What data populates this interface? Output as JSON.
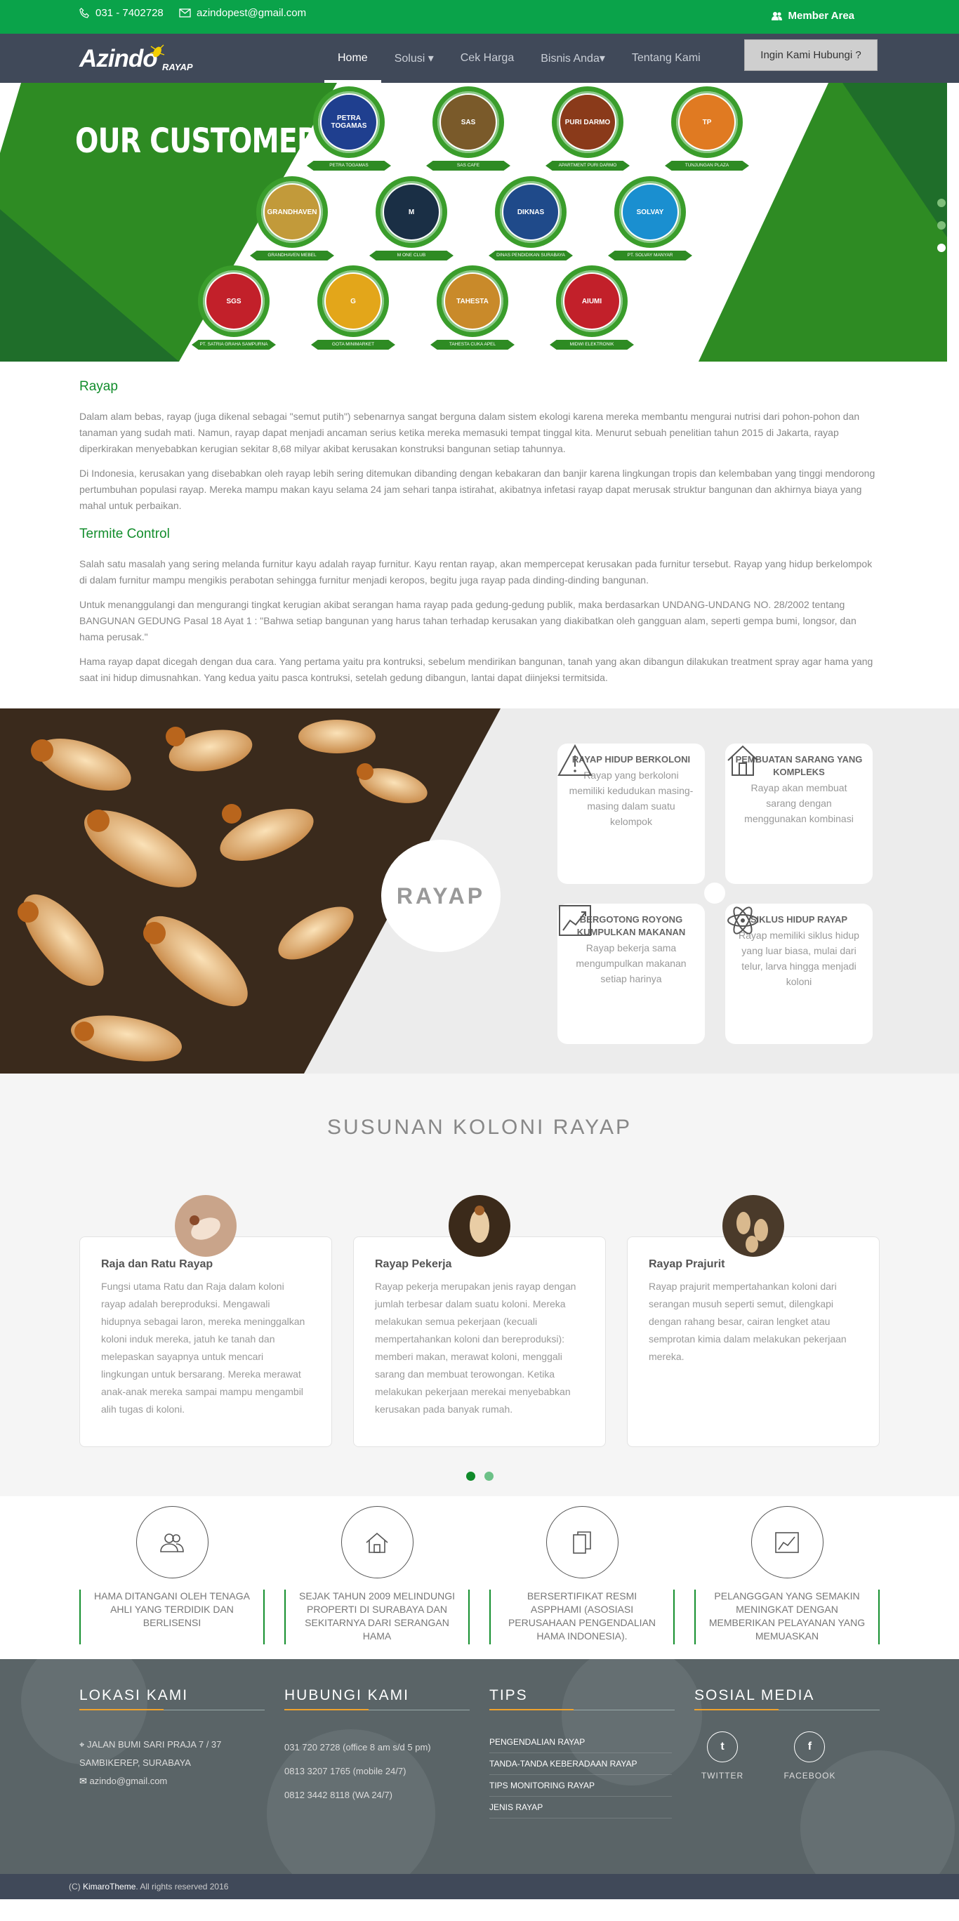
{
  "topbar": {
    "phone": "031 - 7402728",
    "email": "azindopest@gmail.com",
    "member": "Member Area"
  },
  "nav": {
    "logo_main": "Azindo",
    "logo_sub": "RAYAP",
    "items": [
      "Home",
      "Solusi ▾",
      "Cek Harga",
      "Bisnis Anda▾",
      "Tentang Kami"
    ],
    "cta": "Ingin Kami Hubungi ?"
  },
  "hero": {
    "title": "OUR CUSTOMER",
    "customers": [
      {
        "name": "PETRA TOGAMAS",
        "logo": "PETRA TOGAMAS",
        "color": "#1f3f8f"
      },
      {
        "name": "SAS CAFE",
        "logo": "SAS",
        "color": "#7a5a2a"
      },
      {
        "name": "APARTMENT PURI DARMO",
        "logo": "PURI DARMO",
        "color": "#8a3a1a"
      },
      {
        "name": "TUNJUNGAN PLAZA",
        "logo": "TP",
        "color": "#e07a22"
      },
      {
        "name": "GRANDHAVEN MEBEL",
        "logo": "GRANDHAVEN",
        "color": "#c29a3a"
      },
      {
        "name": "M ONE CLUB",
        "logo": "M",
        "color": "#1a2f45"
      },
      {
        "name": "DINAS PENDIDIKAN SURABAYA",
        "logo": "DIKNAS",
        "color": "#1f4a8a"
      },
      {
        "name": "PT. SOLVAY MANYAR",
        "logo": "SOLVAY",
        "color": "#1a8fd0"
      },
      {
        "name": "PT. SATRIA GRAHA SAMPURNA",
        "logo": "SGS",
        "color": "#c2202a"
      },
      {
        "name": "GOTA MINIMARKET",
        "logo": "G",
        "color": "#e3a61a"
      },
      {
        "name": "TAHESTA CUKA APEL",
        "logo": "TAHESTA",
        "color": "#c98a2a"
      },
      {
        "name": "MIDWI ELEKTRONIK",
        "logo": "AIUMI",
        "color": "#c2202a"
      }
    ]
  },
  "content": {
    "h1": "Rayap",
    "p1": "Dalam alam bebas, rayap (juga dikenal sebagai \"semut putih\") sebenarnya sangat berguna dalam sistem ekologi karena mereka membantu mengurai nutrisi dari pohon-pohon dan tanaman yang sudah mati. Namun, rayap dapat menjadi ancaman serius ketika mereka memasuki tempat tinggal kita. Menurut sebuah penelitian tahun 2015 di Jakarta, rayap diperkirakan menyebabkan kerugian sekitar 8,68 milyar akibat kerusakan konstruksi bangunan setiap tahunnya.",
    "p2": "Di Indonesia, kerusakan yang disebabkan oleh rayap lebih sering ditemukan dibanding dengan kebakaran dan banjir karena lingkungan tropis dan kelembaban yang tinggi mendorong pertumbuhan populasi rayap. Mereka mampu makan kayu selama 24 jam sehari tanpa istirahat, akibatnya infetasi rayap dapat merusak struktur bangunan dan akhirnya biaya yang mahal untuk perbaikan.",
    "h2": "Termite Control",
    "p3": "Salah satu masalah yang sering melanda furnitur kayu adalah rayap furnitur. Kayu rentan rayap, akan mempercepat kerusakan pada furnitur tersebut. Rayap yang hidup berkelompok di dalam furnitur mampu mengikis perabotan sehingga furnitur menjadi keropos, begitu juga rayap pada dinding-dinding bangunan.",
    "p4": "Untuk menanggulangi dan mengurangi tingkat kerugian akibat serangan hama rayap pada gedung-gedung publik, maka berdasarkan UNDANG-UNDANG NO. 28/2002 tentang BANGUNAN GEDUNG Pasal 18 Ayat 1 : \"Bahwa setiap bangunan yang harus tahan terhadap kerusakan yang diakibatkan oleh gangguan alam, seperti gempa bumi, longsor, dan hama perusak.\"",
    "p5": "Hama rayap dapat dicegah dengan dua cara. Yang pertama yaitu pra kontruksi, sebelum mendirikan bangunan, tanah yang akan dibangun dilakukan treatment spray agar hama yang saat ini hidup dimusnahkan. Yang kedua yaitu pasca kontruksi, setelah gedung dibangun, lantai dapat diinjeksi termitsida."
  },
  "rayap": {
    "label": "RAYAP",
    "cards": [
      {
        "title": "RAYAP HIDUP BERKOLONI",
        "text": "Rayap yang berkoloni memiliki kedudukan masing-masing dalam suatu kelompok",
        "icon": "warning-icon"
      },
      {
        "title": "PEMBUATAN SARANG YANG KOMPLEKS",
        "text": "Rayap akan membuat sarang dengan menggunakan kombinasi",
        "icon": "home-icon"
      },
      {
        "title": "BERGOTONG ROYONG KUMPULKAN MAKANAN",
        "text": "Rayap bekerja sama mengumpulkan makanan setiap harinya",
        "icon": "chart-icon"
      },
      {
        "title": "SIKLUS HIDUP RAYAP",
        "text": "Rayap memiliki siklus hidup yang luar biasa, mulai dari telur, larva hingga menjadi koloni",
        "icon": "atom-icon"
      }
    ]
  },
  "susunan": {
    "title": "SUSUNAN KOLONI RAYAP",
    "cards": [
      {
        "title": "Raja dan Ratu Rayap",
        "text": "Fungsi utama Ratu dan Raja dalam koloni rayap adalah bereproduksi. Mengawali hidupnya sebagai laron, mereka meninggalkan koloni induk mereka, jatuh ke tanah dan melepaskan sayapnya untuk mencari lingkungan untuk bersarang. Mereka merawat anak-anak mereka sampai mampu mengambil alih tugas di koloni."
      },
      {
        "title": "Rayap Pekerja",
        "text": "Rayap pekerja merupakan jenis rayap dengan jumlah terbesar dalam suatu koloni. Mereka melakukan semua pekerjaan (kecuali mempertahankan koloni dan bereproduksi): memberi makan, merawat koloni, menggali sarang dan membuat terowongan. Ketika melakukan pekerjaan merekai menyebabkan kerusakan pada banyak rumah."
      },
      {
        "title": "Rayap Prajurit",
        "text": "Rayap prajurit mempertahankan koloni dari serangan musuh seperti semut, dilengkapi dengan rahang besar, cairan lengket atau semprotan kimia dalam melakukan pekerjaan mereka."
      }
    ]
  },
  "features": [
    {
      "text": "HAMA DITANGANI OLEH TENAGA AHLI YANG TERDIDIK DAN BERLISENSI",
      "icon": "users-icon"
    },
    {
      "text": "SEJAK TAHUN 2009 MELINDUNGI PROPERTI DI SURABAYA DAN SEKITARNYA DARI SERANGAN HAMA",
      "icon": "home-icon"
    },
    {
      "text": "BERSERTIFIKAT RESMI ASPPHAMI (ASOSIASI PERUSAHAAN PENGENDALIAN HAMA INDONESIA).",
      "icon": "documents-icon"
    },
    {
      "text": "PELANGGGAN YANG SEMAKIN MENINGKAT DENGAN MEMBERIKAN PELAYANAN YANG MEMUASKAN",
      "icon": "chart-icon"
    }
  ],
  "footer": {
    "lokasi": {
      "title": "LOKASI KAMI",
      "addr1": "JALAN BUMI SARI PRAJA 7 / 37",
      "addr2": "SAMBIKEREP, SURABAYA",
      "email": "azindo@gmail.com"
    },
    "hubungi": {
      "title": "HUBUNGI KAMI",
      "lines": [
        "031 720 2728 (office 8 am s/d 5 pm)",
        "0813 3207 1765 (mobile 24/7)",
        "0812 3442 8118 (WA 24/7)"
      ]
    },
    "tips": {
      "title": "TIPS",
      "items": [
        "PENGENDALIAN RAYAP",
        "TANDA-TANDA KEBERADAAN RAYAP",
        "TIPS MONITORING RAYAP",
        "JENIS RAYAP"
      ]
    },
    "sosial": {
      "title": "SOSIAL MEDIA",
      "twitter": "TWITTER",
      "facebook": "FACEBOOK",
      "tw_glyph": "t",
      "fb_glyph": "f"
    }
  },
  "copyright": {
    "prefix": "(C)",
    "brand": "KimaroTheme",
    "suffix": ". All rights reserved 2016"
  }
}
